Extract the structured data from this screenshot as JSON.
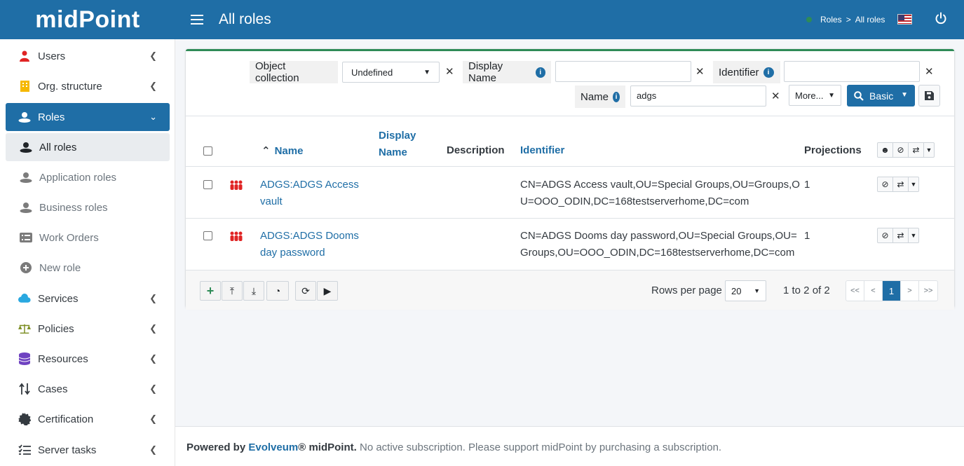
{
  "header": {
    "brand": "midPoint",
    "title": "All roles",
    "breadcrumbs": [
      "Roles",
      ">",
      "All roles"
    ],
    "language": "en-us-flag-icon",
    "colors": {
      "primary": "#1f6ea6",
      "accent": "#2e8b57",
      "danger": "#e02424"
    }
  },
  "sidebar": {
    "items": [
      {
        "label": "Users"
      },
      {
        "label": "Org. structure"
      },
      {
        "label": "Roles"
      },
      {
        "label": "All roles"
      },
      {
        "label": "Application roles"
      },
      {
        "label": "Business roles"
      },
      {
        "label": "Work Orders"
      },
      {
        "label": "New role"
      },
      {
        "label": "Services"
      },
      {
        "label": "Policies"
      },
      {
        "label": "Resources"
      },
      {
        "label": "Cases"
      },
      {
        "label": "Certification"
      },
      {
        "label": "Server tasks"
      }
    ]
  },
  "search": {
    "object_collection_label": "Object collection",
    "object_collection_value": "Undefined",
    "display_name_label": "Display Name",
    "display_name_value": "",
    "identifier_label": "Identifier",
    "identifier_value": "",
    "name_label": "Name",
    "name_value": "adgs",
    "more_label": "More...",
    "basic_label": "Basic"
  },
  "table": {
    "headers": {
      "name": "Name",
      "display_name_1": "Display",
      "display_name_2": "Name",
      "description": "Description",
      "identifier": "Identifier",
      "projections": "Projections"
    },
    "rows": [
      {
        "name_1": "ADGS:ADGS Access",
        "name_2": "vault",
        "identifier_1": "CN=ADGS Access vault,OU=Special Groups,OU=Groups,O",
        "identifier_2": "U=OOO_ODIN,DC=168testserverhome,DC=com",
        "projections": "1"
      },
      {
        "name_1": "ADGS:ADGS Dooms",
        "name_2": "day password",
        "identifier_1": "CN=ADGS Dooms day password,OU=Special Groups,OU=",
        "identifier_2": "Groups,OU=OOO_ODIN,DC=168testserverhome,DC=com",
        "projections": "1"
      }
    ]
  },
  "footer_bar": {
    "rows_per_page_label": "Rows per page",
    "rows_per_page_value": "20",
    "count": "1 to 2 of 2",
    "pager": [
      "<<",
      "<",
      "1",
      ">",
      ">>"
    ]
  },
  "page_footer": {
    "powered_by": "Powered by",
    "company": "Evolveum",
    "product": "® midPoint.",
    "notice": "No active subscription. Please support midPoint by purchasing a subscription."
  }
}
